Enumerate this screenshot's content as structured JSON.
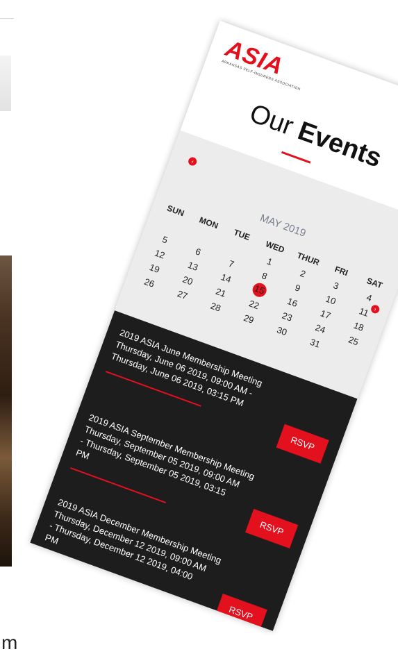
{
  "logo": {
    "word": "ASIA",
    "sub": "ARKANSAS SELF-INSURERS ASSOCIATION"
  },
  "title": {
    "light": "Our",
    "bold": "Events"
  },
  "calendar": {
    "month": "MAY 2019",
    "weekdays": [
      "SUN",
      "MON",
      "TUE",
      "WED",
      "THUR",
      "FRI",
      "SAT"
    ],
    "weeks": [
      [
        "",
        "",
        "",
        "1",
        "2",
        "3",
        "4"
      ],
      [
        "5",
        "6",
        "7",
        "8",
        "9",
        "10",
        "11"
      ],
      [
        "12",
        "13",
        "14",
        "15",
        "16",
        "17",
        "18"
      ],
      [
        "19",
        "20",
        "21",
        "22",
        "23",
        "24",
        "25"
      ],
      [
        "26",
        "27",
        "28",
        "29",
        "30",
        "31",
        ""
      ]
    ],
    "today": "15",
    "prev_icon": "chevron-left-icon",
    "next_icon": "chevron-right-icon"
  },
  "events": [
    {
      "title": "2019 ASIA June Membership Meeting",
      "dates": "Thursday, June 06 2019, 09:00 AM - Thursday, June 06 2019, 03:15 PM",
      "rsvp": "RSVP"
    },
    {
      "title": "2019 ASIA September Membership Meeting",
      "dates": "Thursday, September 05 2019, 09:00 AM - Thursday, September 05 2019, 03:15 PM",
      "rsvp": "RSVP"
    },
    {
      "title": "2019 ASIA December Membership Meeting",
      "dates": "Thursday, December 12 2019, 09:00 AM - Thursday, December 12 2019, 04:00 PM",
      "rsvp": "RSVP"
    }
  ],
  "background": {
    "fragment_text": "m"
  },
  "colors": {
    "accent": "#e3101e",
    "dark": "#1d1d1d",
    "calendar_bg": "#ececec"
  }
}
